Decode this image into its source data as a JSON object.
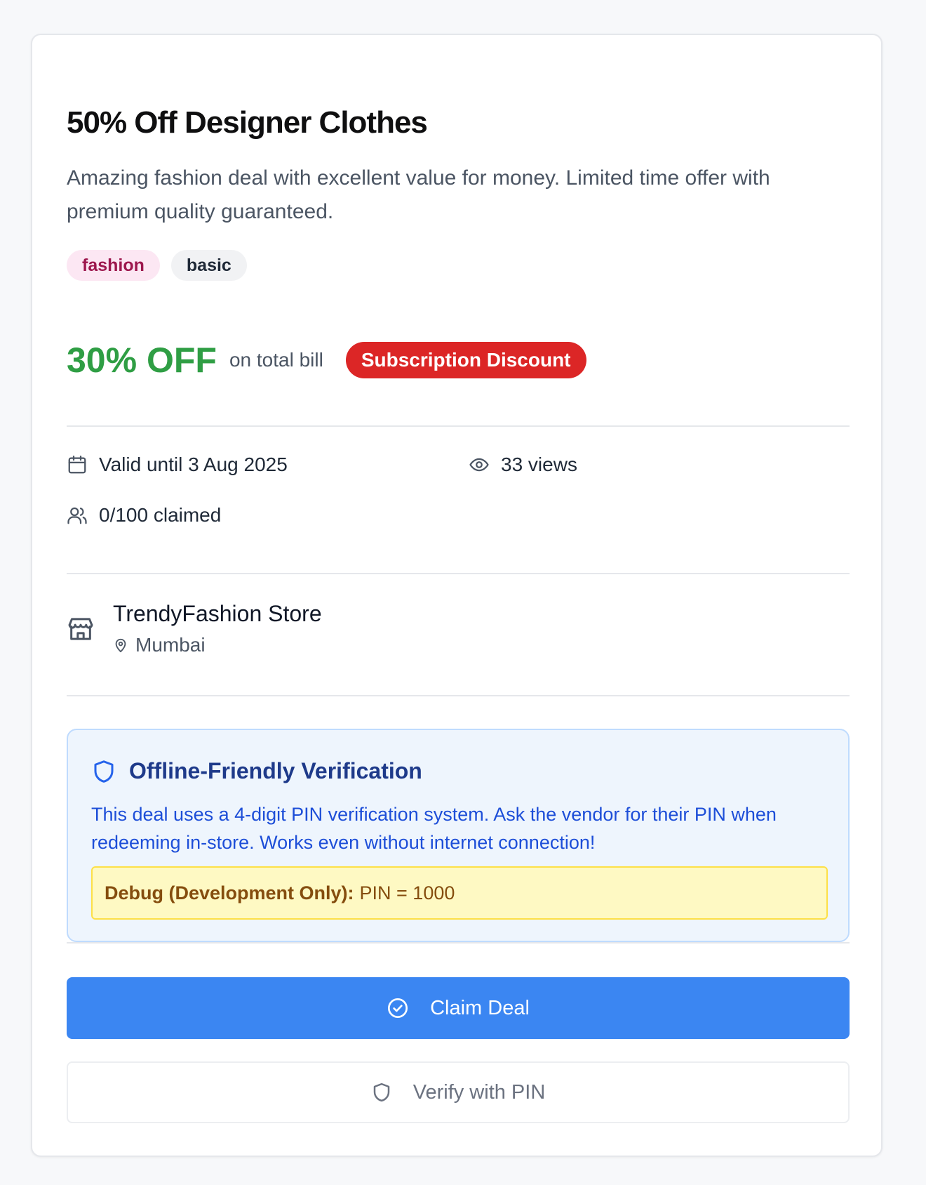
{
  "deal": {
    "title": "50% Off Designer Clothes",
    "description": "Amazing fashion deal with excellent value for money. Limited time offer with premium quality guaranteed.",
    "tags": [
      "fashion",
      "basic"
    ],
    "discount": "30% OFF",
    "discount_scope": "on total bill",
    "badge": "Subscription Discount",
    "valid_until": "Valid until 3 Aug 2025",
    "views": "33 views",
    "claimed": "0/100 claimed"
  },
  "store": {
    "name": "TrendyFashion Store",
    "location": "Mumbai"
  },
  "verification": {
    "title": "Offline-Friendly Verification",
    "text": "This deal uses a 4-digit PIN verification system. Ask the vendor for their PIN when redeeming in-store. Works even without internet connection!",
    "debug_label": "Debug (Development Only):",
    "debug_value": "PIN = 1000"
  },
  "actions": {
    "claim_label": "Claim Deal",
    "verify_label": "Verify with PIN"
  },
  "colors": {
    "discount": "#2f9e44",
    "badge": "#dc2626",
    "primary_button": "#3b86f2",
    "verify_box_bg": "#eef5fd",
    "debug_bg": "#fef9c3"
  },
  "icons": {
    "valid": "calendar-icon",
    "views": "eye-icon",
    "claimed": "users-icon",
    "store": "store-icon",
    "location": "map-pin-icon",
    "verification": "shield-icon",
    "claim": "check-circle-icon",
    "verify": "shield-icon"
  }
}
